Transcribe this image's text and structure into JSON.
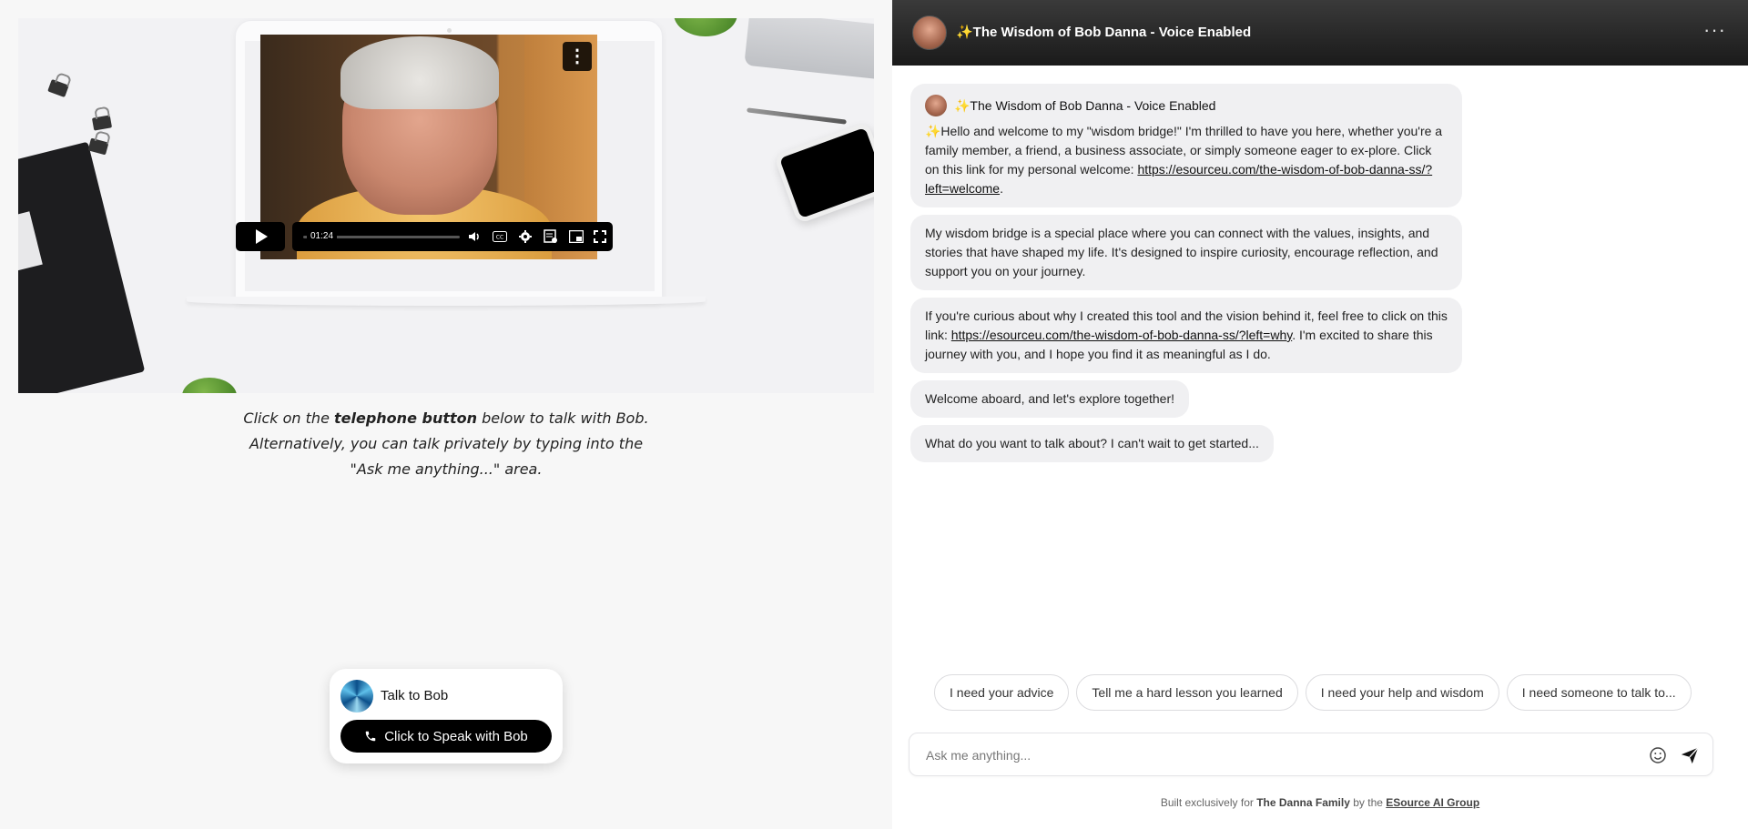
{
  "left": {
    "video": {
      "timestamp_tooltip": "01:24",
      "more_icon": "vertical-dots-icon",
      "controls": [
        "play-icon",
        "volume-icon",
        "captions-icon",
        "settings-icon",
        "transcript-icon",
        "picture-in-picture-icon",
        "fullscreen-icon"
      ]
    },
    "instructions": {
      "line1_prefix": "Click on the ",
      "line1_bold": "telephone button",
      "line1_suffix": " below to talk with Bob.",
      "line2": "Alternatively, you can talk privately by typing into the",
      "line3": "\"Ask me anything...\" area."
    },
    "talk_card": {
      "title": "Talk to Bob",
      "button_label": "Click to Speak with Bob"
    }
  },
  "chat": {
    "header": {
      "title": "✨The Wisdom of Bob Danna - Voice Enabled",
      "more_icon": "horizontal-dots-icon"
    },
    "messages": {
      "first": {
        "sender": "✨The Wisdom of Bob Danna - Voice Enabled",
        "text_before_link": "✨Hello and welcome to my \"wisdom bridge!\" I'm thrilled to have you here, whether you're a family member, a friend, a business associate, or simply someone eager to ex-plore. Click on this link for my personal welcome: ",
        "link": "https://esourceu.com/the-wisdom-of-bob-danna-ss/?left=welcome",
        "text_after_link": "."
      },
      "second": "My wisdom bridge is a special place where you can connect with the values, insights, and stories that have shaped my life. It's designed to inspire curiosity, encourage reflection, and support you on your journey.",
      "third": {
        "text_before_link": "If you're curious about why I created this tool and the vision behind it, feel free to click on this link: ",
        "link": "https://esourceu.com/the-wisdom-of-bob-danna-ss/?left=why",
        "text_after_link": ". I'm excited to share this journey with you, and I hope you find it as meaningful as I do."
      },
      "fourth": "Welcome aboard, and let's explore together!",
      "fifth": "What do you want to talk about? I can't wait to get started..."
    },
    "suggestions": [
      "I need your advice",
      "Tell me a hard lesson you learned",
      "I need your help and wisdom",
      "I need someone to talk to..."
    ],
    "composer": {
      "placeholder": "Ask me anything...",
      "emoji_icon": "smiley-icon",
      "send_icon": "paper-plane-icon"
    },
    "footer": {
      "prefix": "Built exclusively for ",
      "family": "The Danna Family",
      "middle": " by the ",
      "group": "ESource AI Group"
    }
  }
}
